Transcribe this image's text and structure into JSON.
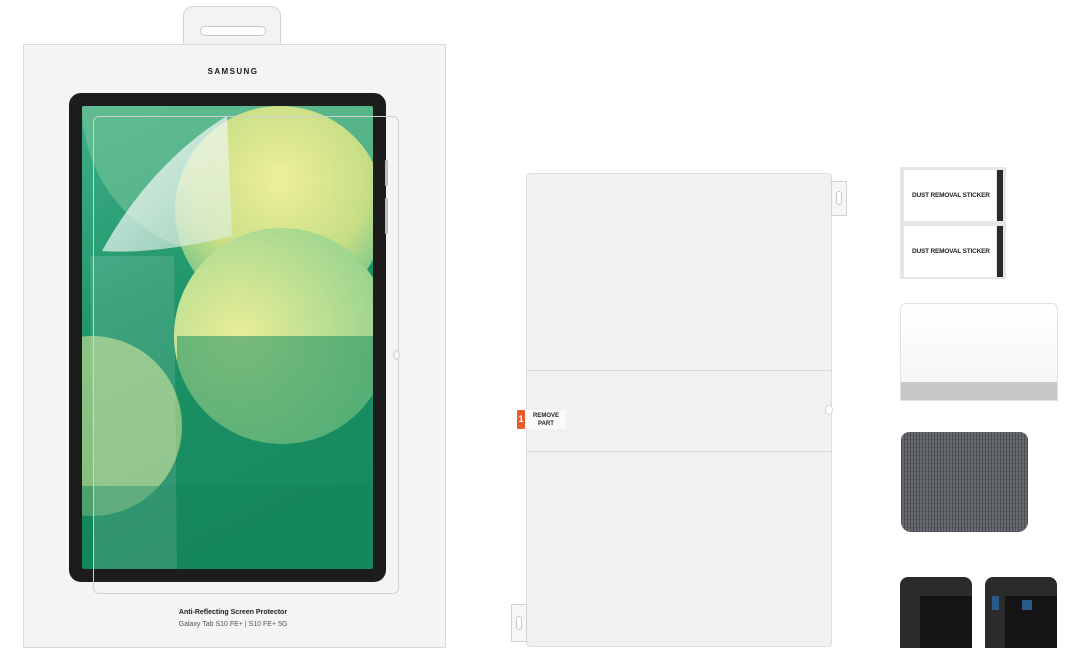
{
  "package": {
    "brand": "SAMSUNG",
    "product_title": "Anti-Reflecting Screen Protector",
    "compatible_models": "Galaxy Tab S10 FE+ | S10 FE+ 5G"
  },
  "protector_film": {
    "step_number": "1",
    "step_label_line1": "REMOVE",
    "step_label_line2": "PART"
  },
  "dust_stickers": [
    {
      "label": "DUST REMOVAL STICKER"
    },
    {
      "label": "DUST REMOVAL STICKER"
    }
  ],
  "colors": {
    "screen_green": "#1f8f63",
    "screen_yellow": "#dfe68a",
    "tablet_bezel": "#1c1c1c",
    "step_badge": "#ea5b2a",
    "cloth_gray": "#5e6267",
    "clip_blue": "#2a5a8a"
  }
}
